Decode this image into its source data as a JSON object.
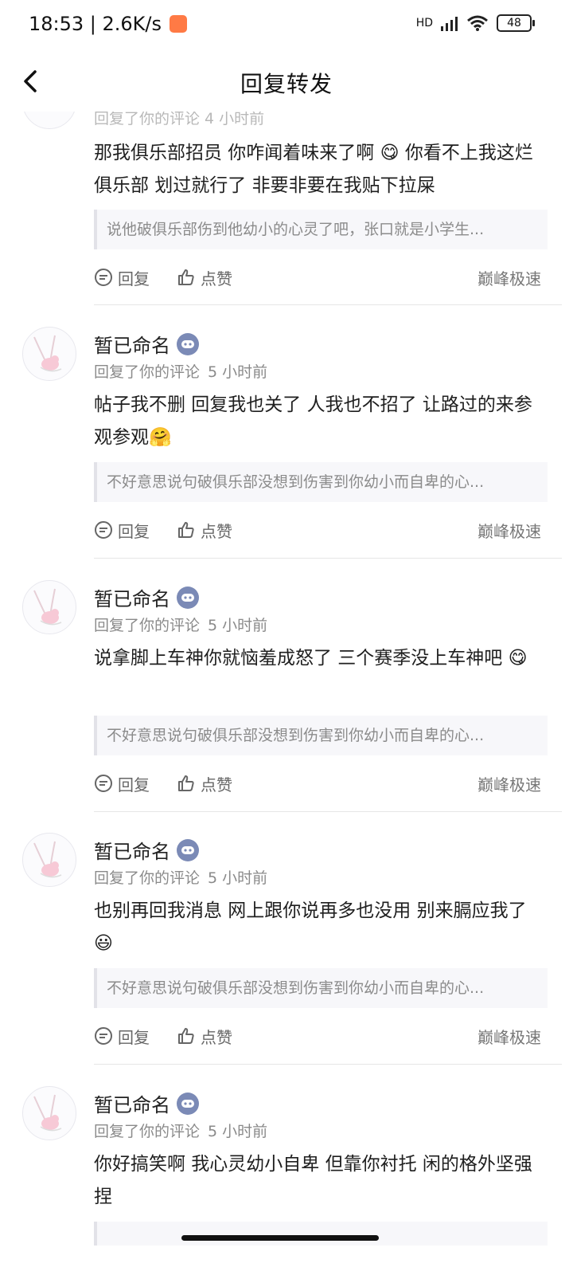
{
  "status_bar": {
    "time_speed": "18:53 | 2.6K/s",
    "hd": "HD",
    "battery": "48"
  },
  "nav": {
    "title": "回复转发"
  },
  "partial_top": {
    "meta": "回复了你的评论 4 小时前",
    "comment": "那我俱乐部招员 你咋闻着味来了啊 😋 你看不上我这烂俱乐部 划过就行了 非要非要在我贴下拉屎",
    "quote": "说他破俱乐部伤到他幼小的心灵了吧，张口就是小学生...",
    "reply_label": "回复",
    "like_label": "点赞",
    "source": "巅峰极速"
  },
  "items": [
    {
      "username": "暂已命名",
      "meta_action": "回复了你的评论",
      "meta_time": "5 小时前",
      "comment": "帖子我不删 回复我也关了 人我也不招了  让路过的来参观参观🤗",
      "quote": "不好意思说句破俱乐部没想到伤害到你幼小而自卑的心...",
      "reply_label": "回复",
      "like_label": "点赞",
      "source": "巅峰极速"
    },
    {
      "username": "暂已命名",
      "meta_action": "回复了你的评论",
      "meta_time": "5 小时前",
      "comment": "说拿脚上车神你就恼羞成怒了 三个赛季没上车神吧 😋",
      "quote": "不好意思说句破俱乐部没想到伤害到你幼小而自卑的心...",
      "reply_label": "回复",
      "like_label": "点赞",
      "source": "巅峰极速"
    },
    {
      "username": "暂已命名",
      "meta_action": "回复了你的评论",
      "meta_time": "5 小时前",
      "comment": "也别再回我消息 网上跟你说再多也没用 别来膈应我了 😃",
      "quote": "不好意思说句破俱乐部没想到伤害到你幼小而自卑的心...",
      "reply_label": "回复",
      "like_label": "点赞",
      "source": "巅峰极速"
    },
    {
      "username": "暂已命名",
      "meta_action": "回复了你的评论",
      "meta_time": "5 小时前",
      "comment": "你好搞笑啊 我心灵幼小自卑 但靠你衬托 闲的格外坚强捏"
    }
  ]
}
